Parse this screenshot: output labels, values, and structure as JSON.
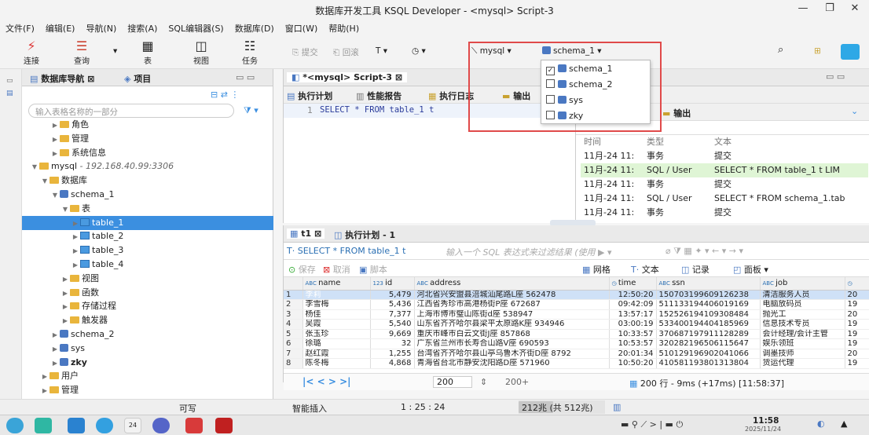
{
  "window": {
    "title": "数据库开发工具 KSQL Developer - <mysql> Script-3"
  },
  "menu": [
    "文件(F)",
    "编辑(E)",
    "导航(N)",
    "搜索(A)",
    "SQL编辑器(S)",
    "数据库(D)",
    "窗口(W)",
    "帮助(H)"
  ],
  "toolbar": {
    "connect": "连接",
    "query": "查询",
    "table": "表",
    "view": "视图",
    "task": "任务",
    "commit": "提交",
    "rollback": "回滚",
    "connection": "mysql",
    "schema": "schema_1"
  },
  "schema_dropdown": [
    {
      "label": "schema_1",
      "checked": true
    },
    {
      "label": "schema_2",
      "checked": false
    },
    {
      "label": "sys",
      "checked": false
    },
    {
      "label": "zky",
      "checked": false
    }
  ],
  "nav": {
    "tab1": "数据库导航",
    "tab2": "项目",
    "filter_placeholder": "输入表格名称的一部分",
    "tree": [
      {
        "label": "角色",
        "indent": 2
      },
      {
        "label": "管理",
        "indent": 2
      },
      {
        "label": "系统信息",
        "indent": 2
      },
      {
        "label": "mysql",
        "detail": " - 192.168.40.99:3306",
        "indent": 0
      },
      {
        "label": "数据库",
        "indent": 1
      },
      {
        "label": "schema_1",
        "indent": 2
      },
      {
        "label": "表",
        "indent": 3
      },
      {
        "label": "table_1",
        "indent": 4
      },
      {
        "label": "table_2",
        "indent": 4
      },
      {
        "label": "table_3",
        "indent": 4
      },
      {
        "label": "table_4",
        "indent": 4
      },
      {
        "label": "视图",
        "indent": 3
      },
      {
        "label": "函数",
        "indent": 3
      },
      {
        "label": "存储过程",
        "indent": 3
      },
      {
        "label": "触发器",
        "indent": 3
      },
      {
        "label": "schema_2",
        "indent": 2
      },
      {
        "label": "sys",
        "indent": 2
      },
      {
        "label": "zky",
        "indent": 2
      },
      {
        "label": "用户",
        "indent": 1
      },
      {
        "label": "管理",
        "indent": 1
      }
    ]
  },
  "editor": {
    "tab": "*<mysql> Script-3",
    "btn_plan": "执行计划",
    "btn_perf": "性能报告",
    "btn_log": "执行日志",
    "btn_out": "输出",
    "line_no": "1",
    "sql": "SELECT * FROM table_1 t"
  },
  "log": {
    "out_tab": "输出",
    "headers": [
      "时间",
      "类型",
      "文本"
    ],
    "rows": [
      {
        "time": "11月-24 11:",
        "type": "事务",
        "text": "提交"
      },
      {
        "time": "11月-24 11:",
        "type": "SQL / User",
        "text": "SELECT * FROM table_1 t  LIM"
      },
      {
        "time": "11月-24 11:",
        "type": "事务",
        "text": "提交"
      },
      {
        "time": "11月-24 11:",
        "type": "SQL / User",
        "text": "SELECT * FROM schema_1.tab"
      },
      {
        "time": "11月-24 11:",
        "type": "事务",
        "text": "提交"
      }
    ]
  },
  "results": {
    "tab1": "t1",
    "tab2": "执行计划 - 1",
    "filter_sql": "SELECT * FROM table_1 t",
    "filter_placeholder": "输入一个 SQL 表达式来过滤结果 (使用",
    "save": "保存",
    "cancel": "取消",
    "script": "脚本",
    "grid": "网格",
    "text": "文本",
    "record": "记录",
    "panel": "面板",
    "columns": [
      "name",
      "id",
      "address",
      "time",
      "ssn",
      "job",
      ""
    ],
    "rows": [
      [
        "1",
        "李莉",
        "5,479",
        "河北省兴安盟县涪城汕尾路L座 562478",
        "12:50:20",
        "150703199609126238",
        "清洁服务人员",
        "20"
      ],
      [
        "2",
        "李雪梅",
        "5,436",
        "江西省秀珍市高港杨街P座 672687",
        "09:42:09",
        "511133194406019169",
        "电脑放码员",
        "19"
      ],
      [
        "3",
        "杨佳",
        "7,377",
        "上海市博市璧山陈街d座 538947",
        "13:57:17",
        "152526194109308484",
        "抛光工",
        "20"
      ],
      [
        "4",
        "吴霞",
        "5,540",
        "山东省齐齐哈尔县梁平太原路K座 934946",
        "03:00:19",
        "533400194404185969",
        "信息技术专员",
        "19"
      ],
      [
        "5",
        "张玉珍",
        "9,669",
        "重庆市峰市白云文街J座 857868",
        "10:33:57",
        "370687197911128289",
        "会计经理/会计主管",
        "19"
      ],
      [
        "6",
        "徐璐",
        "32",
        "广东省兰州市长寿合山路V座 690593",
        "10:53:57",
        "320282196506115647",
        "娱乐领班",
        "19"
      ],
      [
        "7",
        "赵红霞",
        "1,255",
        "台湾省齐齐哈尔县山亭乌鲁木齐街D座 8792",
        "20:01:34",
        "510129196902041066",
        "调墨技师",
        "20"
      ],
      [
        "8",
        "陈冬梅",
        "4,868",
        "青海省台北市静安沈阳路D座 571960",
        "10:50:20",
        "410581193801313804",
        "货运代理",
        "19"
      ]
    ],
    "page_size": "200",
    "page_more": "200+",
    "summary": "200 行 - 9ms (+17ms) [11:58:37]"
  },
  "status": {
    "writable": "可写",
    "insert": "智能插入",
    "pos": "1 : 25 : 24",
    "mem": "212兆 (共 512兆)"
  },
  "taskbar": {
    "time": "11:58",
    "date": "2025/11/24",
    "badge": "24"
  }
}
